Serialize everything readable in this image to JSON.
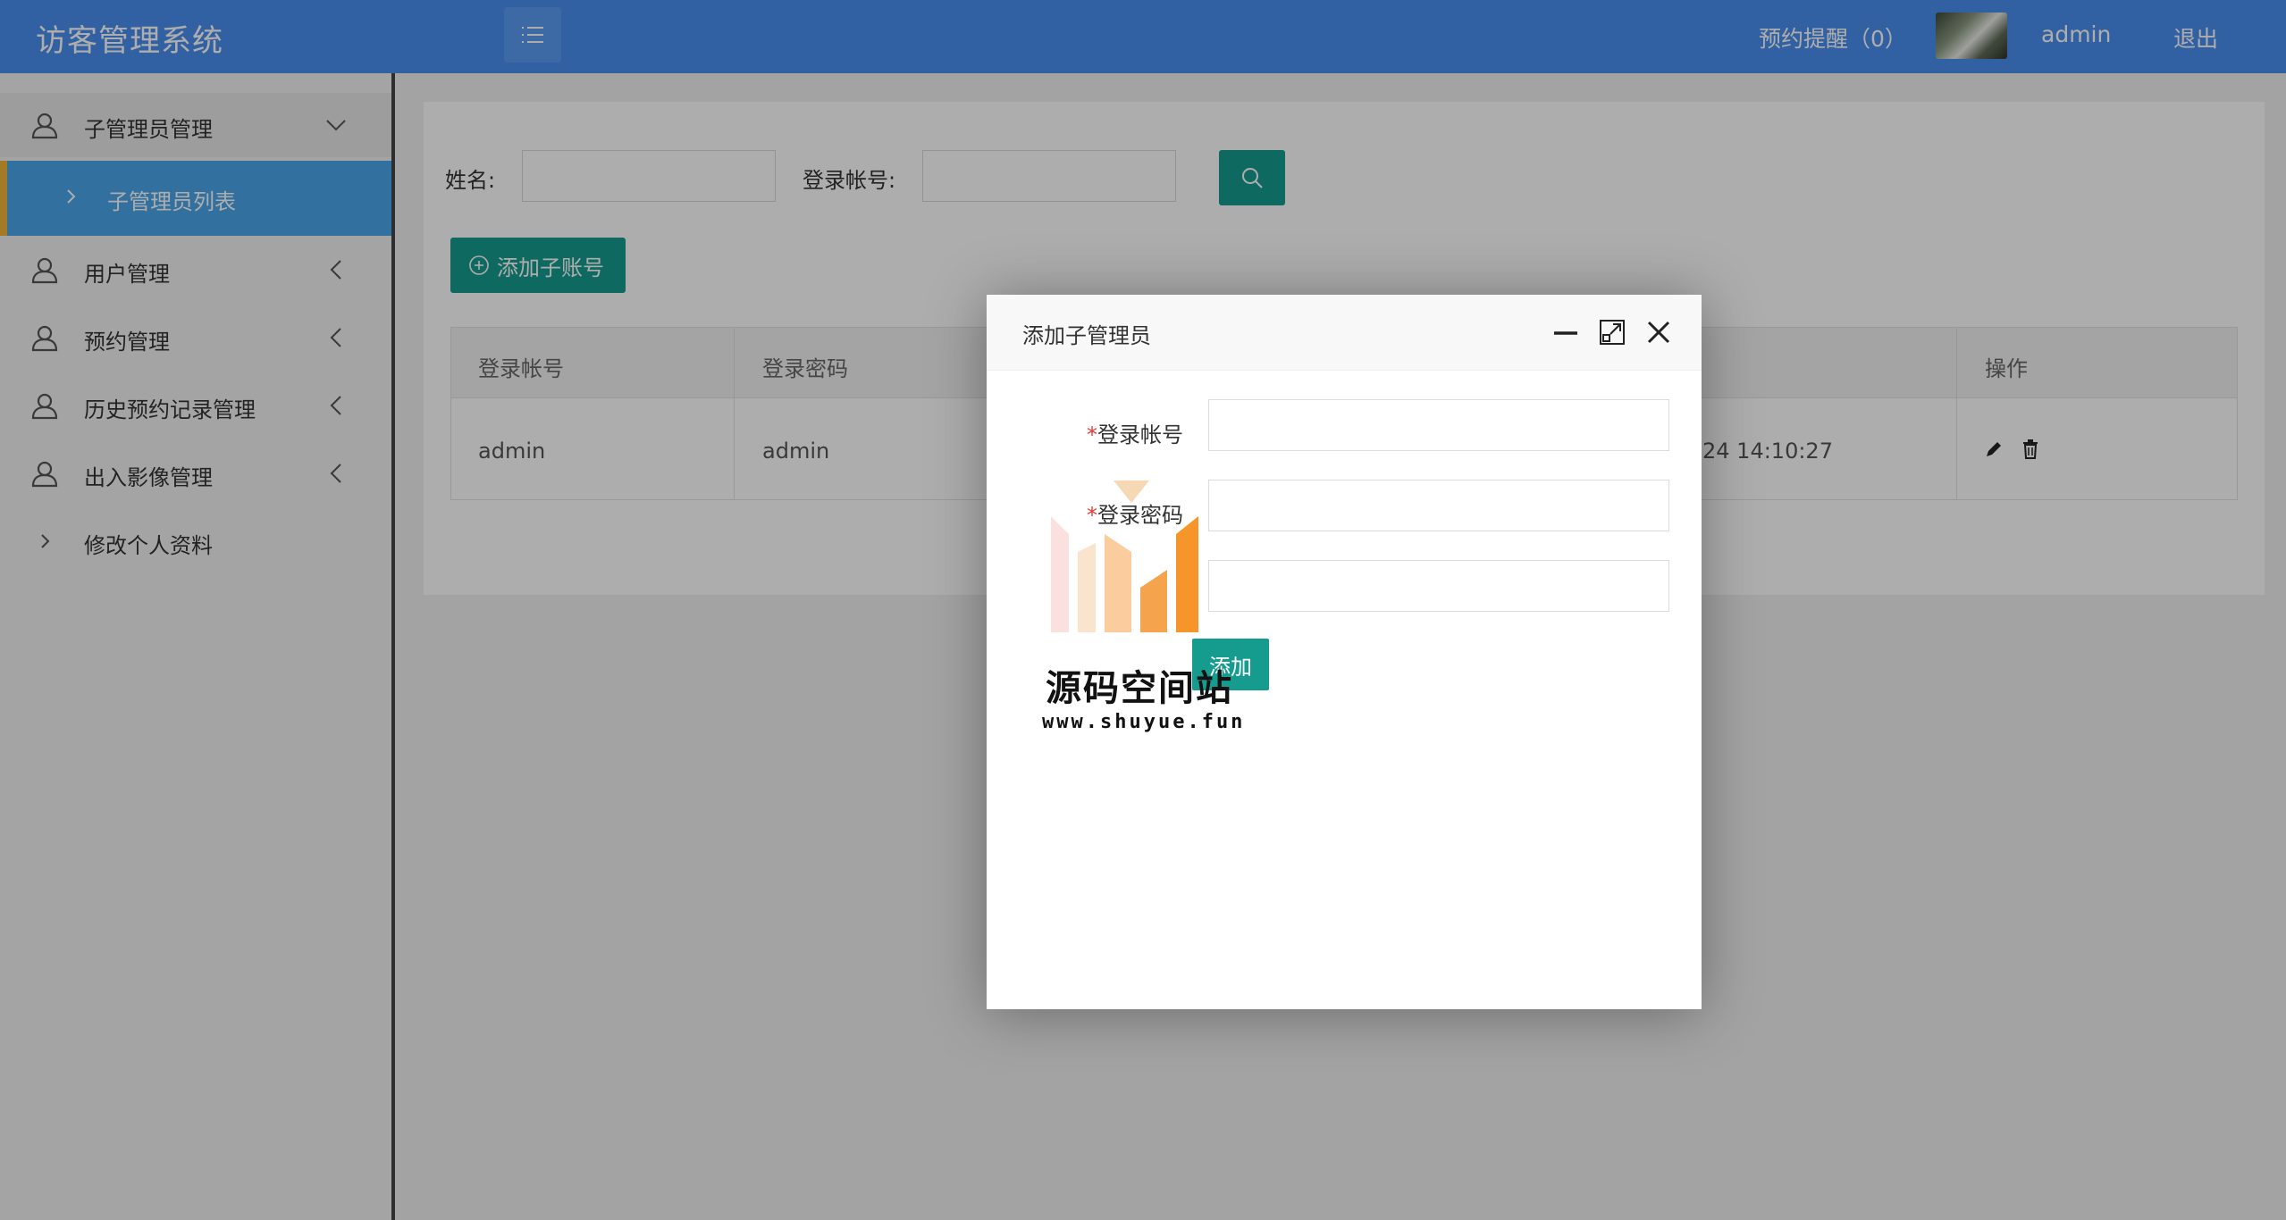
{
  "header": {
    "title": "访客管理系统",
    "reminder": "预约提醒（0）",
    "username": "admin",
    "logout": "退出"
  },
  "sidebar": {
    "items": [
      {
        "label": "子管理员管理"
      },
      {
        "label": "子管理员列表"
      },
      {
        "label": "用户管理"
      },
      {
        "label": "预约管理"
      },
      {
        "label": "历史预约记录管理"
      },
      {
        "label": "出入影像管理"
      },
      {
        "label": "修改个人资料"
      }
    ]
  },
  "search": {
    "name_label": "姓名:",
    "account_label": "登录帐号:",
    "name_value": "",
    "account_value": ""
  },
  "toolbar": {
    "add_label": "添加子账号"
  },
  "table": {
    "headers": [
      "登录帐号",
      "登录密码",
      "操作"
    ],
    "rows": [
      {
        "account": "admin",
        "password": "admin",
        "time": "24 14:10:27"
      }
    ]
  },
  "modal": {
    "title": "添加子管理员",
    "fields": [
      {
        "label": "登录帐号",
        "required": true,
        "value": ""
      },
      {
        "label": "登录密码",
        "required": true,
        "value": ""
      },
      {
        "label": "",
        "required": false,
        "value": ""
      }
    ],
    "submit_label": "添加"
  },
  "watermark": {
    "title": "源码空间站",
    "url": "www.shuyue.fun"
  },
  "colors": {
    "header_bg": "#4a90f0",
    "sidebar_active": "#4aa6ea",
    "sidebar_marker": "#f2b43a",
    "button_green": "#169c8f",
    "required_red": "#e53935"
  }
}
